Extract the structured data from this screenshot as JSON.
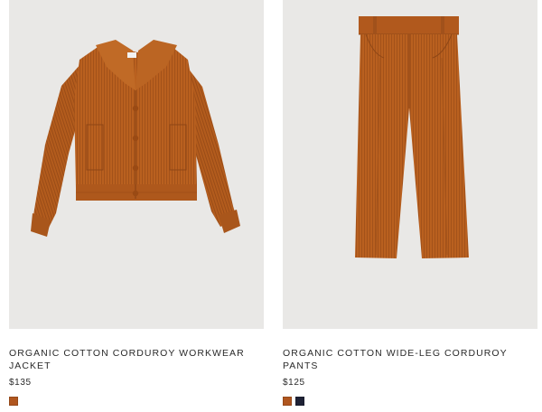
{
  "products": [
    {
      "title": "ORGANIC COTTON CORDUROY WORKWEAR JACKET",
      "price": "$135",
      "image": "corduroy-jacket",
      "swatches": [
        "#b0561f"
      ]
    },
    {
      "title": "ORGANIC COTTON WIDE-LEG CORDUROY PANTS",
      "price": "$125",
      "image": "corduroy-pants",
      "swatches": [
        "#b0561f",
        "#1f2236"
      ]
    }
  ]
}
